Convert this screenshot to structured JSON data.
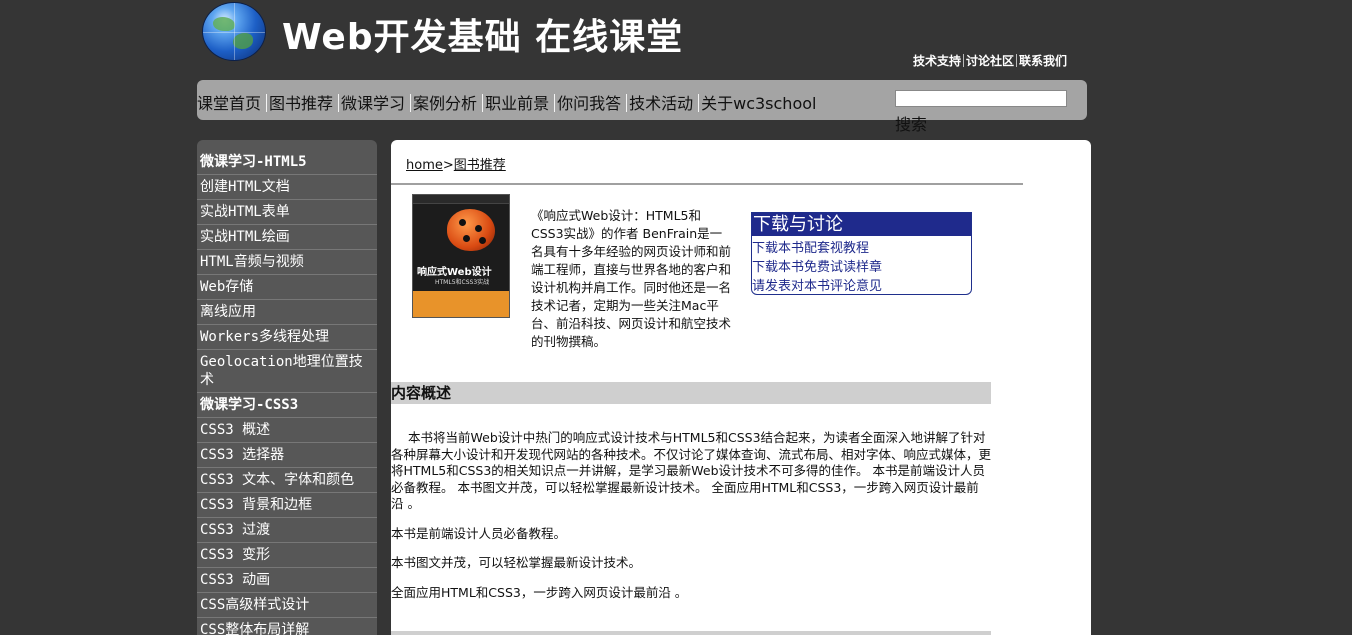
{
  "header": {
    "title": "Web开发基础 在线课堂",
    "top_links": [
      "技术支持",
      "讨论社区",
      "联系我们"
    ]
  },
  "nav": {
    "items": [
      "课堂首页",
      "图书推荐",
      "微课学习",
      "案例分析",
      "职业前景",
      "你问我答",
      "技术活动",
      "关于wc3school"
    ],
    "search_button": "搜索",
    "search_value": ""
  },
  "sidebar": {
    "items": [
      {
        "label": "微课学习-HTML5",
        "heading": true
      },
      {
        "label": "创建HTML文档"
      },
      {
        "label": "实战HTML表单"
      },
      {
        "label": "实战HTML绘画"
      },
      {
        "label": "HTML音频与视频"
      },
      {
        "label": "Web存储"
      },
      {
        "label": "离线应用"
      },
      {
        "label": "Workers多线程处理"
      },
      {
        "label": "Geolocation地理位置技术"
      },
      {
        "label": "微课学习-CSS3",
        "heading": true
      },
      {
        "label": "CSS3 概述"
      },
      {
        "label": "CSS3 选择器"
      },
      {
        "label": "CSS3 文本、字体和颜色"
      },
      {
        "label": "CSS3 背景和边框"
      },
      {
        "label": "CSS3 过渡"
      },
      {
        "label": "CSS3 变形"
      },
      {
        "label": "CSS3 动画"
      },
      {
        "label": "CSS高级样式设计"
      },
      {
        "label": "CSS整体布局详解"
      }
    ]
  },
  "breadcrumb": {
    "home": "home",
    "separator": ">",
    "current": "图书推荐"
  },
  "book": {
    "cover_title": "响应式Web设计",
    "cover_subtitle": "HTML5和CSS3实战",
    "intro": "《响应式Web设计：HTML5和CSS3实战》的作者 BenFrain是一名具有十多年经验的网页设计师和前端工程师，直接与世界各地的客户和设计机构并肩工作。同时他还是一名技术记者，定期为一些关注Mac平台、前沿科技、网页设计和航空技术的刊物撰稿。"
  },
  "download": {
    "title": "下载与讨论",
    "links": [
      "下载本书配套视教程",
      "下载本书免费试读样章",
      "请发表对本书评论意见"
    ]
  },
  "content": {
    "section_title": "内容概述",
    "paragraphs": [
      "本书将当前Web设计中热门的响应式设计技术与HTML5和CSS3结合起来，为读者全面深入地讲解了针对各种屏幕大小设计和开发现代网站的各种技术。不仅讨论了媒体查询、流式布局、相对字体、响应式媒体，更将HTML5和CSS3的相关知识点一并讲解，是学习最新Web设计技术不可多得的佳作。 本书是前端设计人员必备教程。 本书图文并茂，可以轻松掌握最新设计技术。 全面应用HTML和CSS3，一步跨入网页设计最前沿 。",
      "本书是前端设计人员必备教程。",
      "本书图文并茂，可以轻松掌握最新设计技术。",
      "全面应用HTML和CSS3，一步跨入网页设计最前沿 。"
    ]
  },
  "colors": {
    "page_bg": "#353535",
    "nav_bg": "#a4a4a4",
    "sidebar_bg": "#575757",
    "download_header_bg": "#1f2a8c",
    "section_bar": "#cfcfcf"
  }
}
